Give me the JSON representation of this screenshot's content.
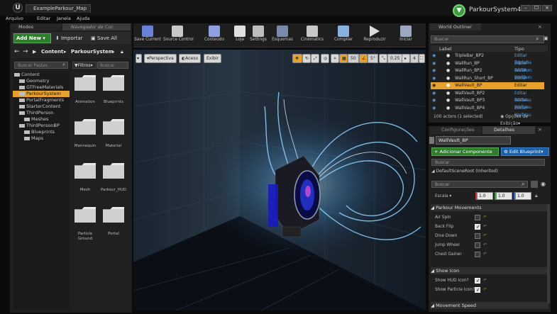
{
  "window": {
    "doc_tab": "ExampleParkour_Map",
    "project_name": "ParkourSystem4",
    "min": "–",
    "max": "☐",
    "close": "×"
  },
  "menu": [
    "Arquivo",
    "Editar",
    "Janela",
    "Ajuda"
  ],
  "left_panel": {
    "tab_modes": "Modos",
    "tab_navigator": "Navegador de Cor.",
    "add_new": "Add New",
    "import": "Importar",
    "save_all": "Save All",
    "breadcrumb": [
      "Content",
      "ParkourSystem"
    ],
    "folders_search_placeholder": "Buscar Pastas",
    "filters": "Filtros",
    "assets_search_placeholder": "Buscar",
    "tree": [
      {
        "label": "Content",
        "depth": 0
      },
      {
        "label": "Geometry",
        "depth": 1
      },
      {
        "label": "GTFreeMaterials",
        "depth": 1
      },
      {
        "label": "ParkourSystem",
        "depth": 1,
        "selected": true
      },
      {
        "label": "PortalFragments",
        "depth": 1
      },
      {
        "label": "StarterContent",
        "depth": 1
      },
      {
        "label": "ThirdPerson",
        "depth": 1
      },
      {
        "label": "Meshes",
        "depth": 2
      },
      {
        "label": "ThirdPersonBP",
        "depth": 1
      },
      {
        "label": "Blueprints",
        "depth": 2
      },
      {
        "label": "Maps",
        "depth": 2
      }
    ],
    "assets": [
      "Animation",
      "Blueprints",
      "Mannequin",
      "Material",
      "Mesh",
      "Parkour_HUD",
      "Particle Ground",
      "Portal"
    ]
  },
  "toolbar": [
    {
      "label": "Save Current",
      "icon": "save-icon"
    },
    {
      "label": "Source Control",
      "icon": "source-control-icon"
    },
    {
      "label": "Conteúdo",
      "icon": "content-icon"
    },
    {
      "label": "Loja",
      "icon": "marketplace-icon"
    },
    {
      "label": "Settings",
      "icon": "settings-icon"
    },
    {
      "label": "Esquemas",
      "icon": "blueprints-icon"
    },
    {
      "label": "Cinematics",
      "icon": "cinematics-icon"
    },
    {
      "label": "Compilar",
      "icon": "build-icon"
    },
    {
      "label": "Reproduzir",
      "icon": "play-icon"
    },
    {
      "label": "Iniciar",
      "icon": "launch-icon"
    }
  ],
  "viewport": {
    "perspective": "Perspectiva",
    "lit": "Aceso",
    "show": "Exibir",
    "grid_snap": "50",
    "angle_snap": "5°",
    "scale_snap": "0.25",
    "camera_speed": "4"
  },
  "outliner": {
    "tab": "World Outliner",
    "search_placeholder": "Buscar",
    "col_label": "Label",
    "col_type": "Tipo",
    "rows": [
      {
        "label": "TripleBar_BP2",
        "type": "Editar TripleBa"
      },
      {
        "label": "WallRun_BP",
        "type": "Editar WallRun"
      },
      {
        "label": "WallRun_BP2",
        "type": "Editar WallRun"
      },
      {
        "label": "WallRun_Short_BP",
        "type": "Editar WallRun"
      },
      {
        "label": "WallVault_BP",
        "type": "Editar WallVau",
        "selected": true
      },
      {
        "label": "WallVault_BP2",
        "type": "Editar WallVau"
      },
      {
        "label": "WallVault_BP3",
        "type": "Editar WallVau"
      },
      {
        "label": "WallVault_BP4",
        "type": "Editar WallVau"
      }
    ],
    "footer_count": "100 actors (1 selected)",
    "view_options": "Opções de Exibição"
  },
  "details": {
    "tab_world_settings": "Configurações do",
    "tab_details": "Detalhes",
    "actor_name": "WallVault_BP",
    "add_component": "+ Adicionar Componente",
    "edit_blueprint": "Edit Blueprint",
    "search_placeholder": "Buscar",
    "scene_root": "DefaultSceneRoot (Inherited)",
    "search2_placeholder": "Buscar",
    "scale_label": "Escala",
    "scale": [
      "1.0",
      "1.0",
      "1.0"
    ],
    "section_movements": "Parkour Movements",
    "movements": [
      {
        "label": "Air Spin",
        "checked": false
      },
      {
        "label": "Back Flip",
        "checked": true
      },
      {
        "label": "Dive Down",
        "checked": false
      },
      {
        "label": "Jump Wheel",
        "checked": false
      },
      {
        "label": "Chest Gainer",
        "checked": false
      }
    ],
    "section_icon": "Show Icon",
    "icons": [
      {
        "label": "Show HUD Icon?",
        "checked": true
      },
      {
        "label": "Show Particle Icon?",
        "checked": true
      }
    ],
    "section_speed": "Movement Speed"
  },
  "colors": {
    "accent_orange": "#e6a22c",
    "green": "#2d7d2d",
    "blue": "#1b5fa8",
    "portal_glow": "#5ab8ff"
  }
}
